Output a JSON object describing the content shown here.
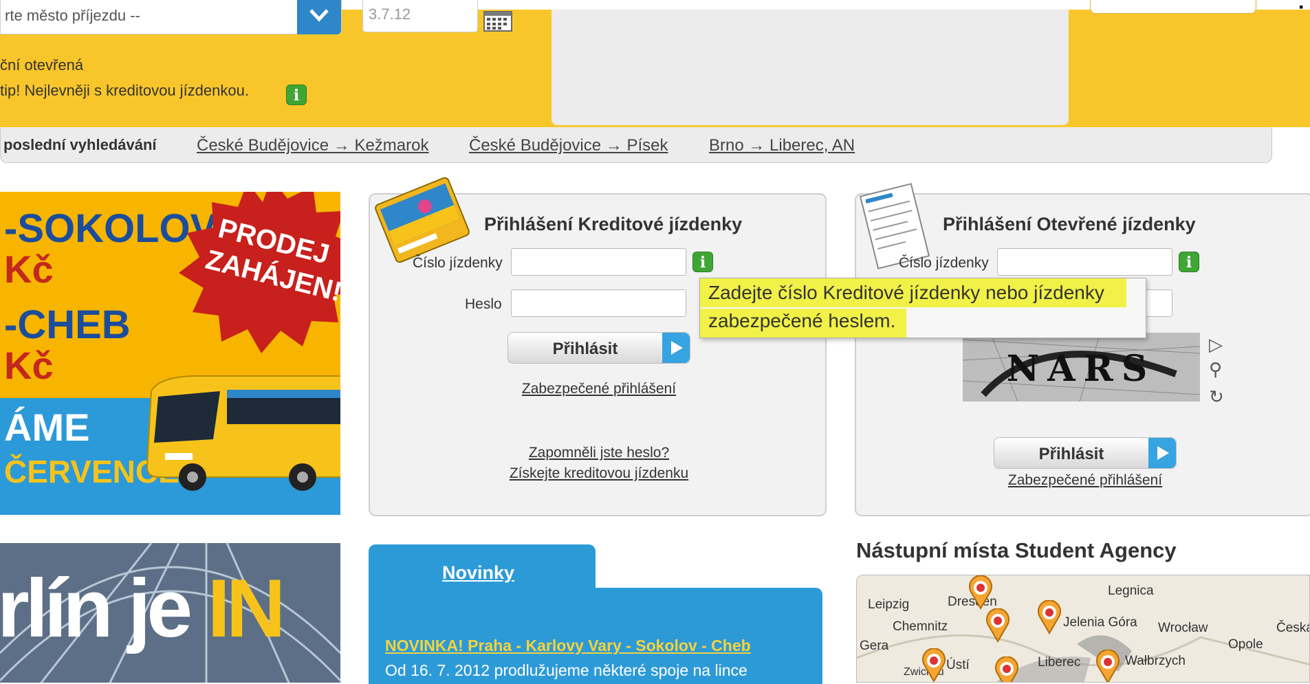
{
  "search": {
    "arrival_city_placeholder": "rte město příjezdu --",
    "date_value": "3.7.12",
    "tagline_1": "ční otevřená",
    "tagline_2": "tip! Nejlevněji s kreditovou jízdenkou."
  },
  "last_searches": {
    "label": "poslední vyhledávání",
    "items": [
      "České Budějovice → Kežmarok",
      "České Budějovice → Písek",
      "Brno → Liberec, AN"
    ]
  },
  "promo_banner": {
    "line1": "-SOKOLOV",
    "line2": "Kč",
    "line3": "-CHEB",
    "line4": "Kč",
    "line5": "ÁME",
    "line6": "ČERVENCE",
    "starburst_line1": "PRODEJ",
    "starburst_line2": "ZAHÁJEN!"
  },
  "credit_login": {
    "title": "Přihlášení Kreditové jízdenky",
    "ticket_label": "Číslo jízdenky",
    "password_label": "Heslo",
    "login_button": "Přihlásit",
    "secure_login": "Zabezpečené přihlášení",
    "forgot_password": "Zapomněli jste heslo?",
    "get_credit_ticket": "Získejte kreditovou jízdenku"
  },
  "open_login": {
    "title": "Přihlášení Otevřené jízdenky",
    "ticket_label": "Číslo jízdenky",
    "captcha_text": "NARS",
    "login_button": "Přihlásit",
    "secure_login": "Zabezpečené přihlášení"
  },
  "tooltip": {
    "line1": "Zadejte číslo Kreditové jízdenky nebo jízdenky",
    "line2": "zabezpečené heslem."
  },
  "news": {
    "tab": "Novinky",
    "headline": "NOVINKA! Praha - Karlovy Vary - Sokolov - Cheb",
    "text": "Od 16. 7. 2012 prodlužujeme některé spoje na lince"
  },
  "berlin_banner": {
    "text_main": "rlín je ",
    "text_accent": "IN"
  },
  "map": {
    "title": "Nástupní místa Student Agency",
    "cities": [
      "Leipzig",
      "Dresden",
      "Legnica",
      "Chemnitz",
      "Jelenia Góra",
      "Wrocław",
      "Česká",
      "Gera",
      "Opole",
      "Ústí",
      "Liberec",
      "Wałbrzych",
      "Zwickau"
    ]
  },
  "colors": {
    "brand_yellow": "#f8c62a",
    "brand_blue": "#2d9ad8",
    "info_green": "#3fa534",
    "highlight": "#f0f028"
  },
  "icons": [
    "chevron-down-icon",
    "calendar-icon",
    "info-icon",
    "play-icon",
    "zoom-icon",
    "refresh-icon",
    "map-pin-icon"
  ]
}
